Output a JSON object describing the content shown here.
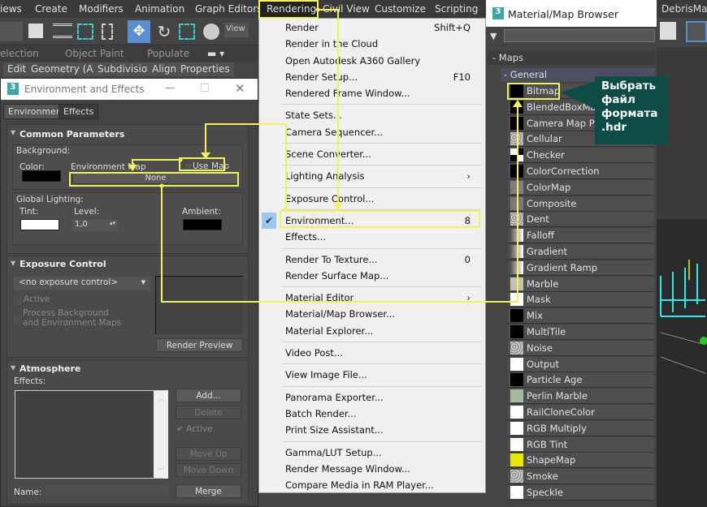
{
  "menubar": {
    "items": [
      "iews",
      "Create",
      "Modifiers",
      "Animation",
      "Graph Editors",
      "Rendering",
      "Civil View",
      "Customize",
      "Scripting"
    ]
  },
  "toolbar": {
    "view_label": "View"
  },
  "ribbon": {
    "tabs1": [
      "election",
      "Object Paint",
      "Populate"
    ],
    "tabs2": [
      "Edit",
      "Geometry (All)",
      "Subdivision",
      "Align",
      "Properties"
    ]
  },
  "env_window": {
    "title": "Environment and Effects",
    "tabs": [
      "Environment",
      "Effects"
    ],
    "common": {
      "title": "Common Parameters",
      "background": "Background:",
      "color": "Color:",
      "env_map": "Environment Map",
      "use_map": "Use Map",
      "map_button": "None",
      "global_lighting": "Global Lighting:",
      "tint": "Tint:",
      "level": "Level:",
      "level_value": "1,0",
      "ambient": "Ambient:"
    },
    "exposure": {
      "title": "Exposure Control",
      "dropdown": "<no exposure control>",
      "active": "Active",
      "process": "Process Background",
      "process2": "and Environment Maps",
      "render_preview": "Render Preview"
    },
    "atmosphere": {
      "title": "Atmosphere",
      "effects": "Effects:",
      "add": "Add...",
      "delete": "Delete",
      "active": "Active",
      "move_up": "Move Up",
      "move_down": "Move Down",
      "name": "Name:",
      "merge": "Merge"
    }
  },
  "rendering_menu": {
    "groups": [
      [
        {
          "label": "Render",
          "shortcut": "Shift+Q"
        },
        {
          "label": "Render in the Cloud"
        },
        {
          "label": "Open Autodesk A360 Gallery"
        },
        {
          "label": "Render Setup...",
          "shortcut": "F10"
        },
        {
          "label": "Rendered Frame Window..."
        }
      ],
      [
        {
          "label": "State Sets..."
        },
        {
          "label": "Camera Sequencer..."
        }
      ],
      [
        {
          "label": "Scene Converter..."
        }
      ],
      [
        {
          "label": "Lighting Analysis",
          "submenu": true
        }
      ],
      [
        {
          "label": "Exposure Control..."
        }
      ],
      [
        {
          "label": "Environment...",
          "shortcut": "8",
          "checked": true
        },
        {
          "label": "Effects..."
        }
      ],
      [
        {
          "label": "Render To Texture...",
          "shortcut": "0"
        },
        {
          "label": "Render Surface Map..."
        }
      ],
      [
        {
          "label": "Material Editor",
          "submenu": true
        },
        {
          "label": "Material/Map Browser..."
        },
        {
          "label": "Material Explorer..."
        }
      ],
      [
        {
          "label": "Video Post..."
        }
      ],
      [
        {
          "label": "View Image File..."
        }
      ],
      [
        {
          "label": "Panorama Exporter..."
        },
        {
          "label": "Batch Render..."
        },
        {
          "label": "Print Size Assistant..."
        }
      ],
      [
        {
          "label": "Gamma/LUT Setup..."
        },
        {
          "label": "Render Message Window..."
        },
        {
          "label": "Compare Media in RAM Player..."
        }
      ]
    ]
  },
  "browser": {
    "title": "Material/Map Browser",
    "maps": "- Maps",
    "general": "- General",
    "items": [
      {
        "label": "Bitmap",
        "swatch": "#000000"
      },
      {
        "label": "BlendedBoxMap",
        "swatch": "#000000"
      },
      {
        "label": "Camera Map Per",
        "swatch": "#000000"
      },
      {
        "label": "Cellular",
        "swatch": "noise"
      },
      {
        "label": "Checker",
        "swatch": "checker"
      },
      {
        "label": "ColorCorrection",
        "swatch": "#000000"
      },
      {
        "label": "ColorMap",
        "swatch": "#808080"
      },
      {
        "label": "Composite",
        "swatch": "#7a7a7a"
      },
      {
        "label": "Dent",
        "swatch": "noise"
      },
      {
        "label": "Falloff",
        "swatch": "gradient"
      },
      {
        "label": "Gradient",
        "swatch": "gradient"
      },
      {
        "label": "Gradient Ramp",
        "swatch": "gradient"
      },
      {
        "label": "Marble",
        "swatch": "#c8c0a8"
      },
      {
        "label": "Mask",
        "swatch": "#ffffff"
      },
      {
        "label": "Mix",
        "swatch": "#000000"
      },
      {
        "label": "MultiTile",
        "swatch": "#000000"
      },
      {
        "label": "Noise",
        "swatch": "noise"
      },
      {
        "label": "Output",
        "swatch": "#ffffff"
      },
      {
        "label": "Particle Age",
        "swatch": "#000000"
      },
      {
        "label": "Perlin Marble",
        "swatch": "#a8b8a0"
      },
      {
        "label": "RailCloneColor",
        "swatch": "#ffffff"
      },
      {
        "label": "RGB Multiply",
        "swatch": "#ffffff"
      },
      {
        "label": "RGB Tint",
        "swatch": "#ffffff"
      },
      {
        "label": "ShapeMap",
        "swatch": "#e8e800"
      },
      {
        "label": "Smoke",
        "swatch": "noise"
      },
      {
        "label": "Speckle",
        "swatch": "#ffffff"
      }
    ]
  },
  "right_pane": {
    "title": "DebrisMake"
  },
  "annotation": {
    "text": [
      "Выбрать",
      "файл",
      "формата",
      ".hdr"
    ],
    "bg": "#0d4b46"
  },
  "colors": {
    "highlight": "#f2f25a",
    "accent": "#5a8fd6"
  }
}
